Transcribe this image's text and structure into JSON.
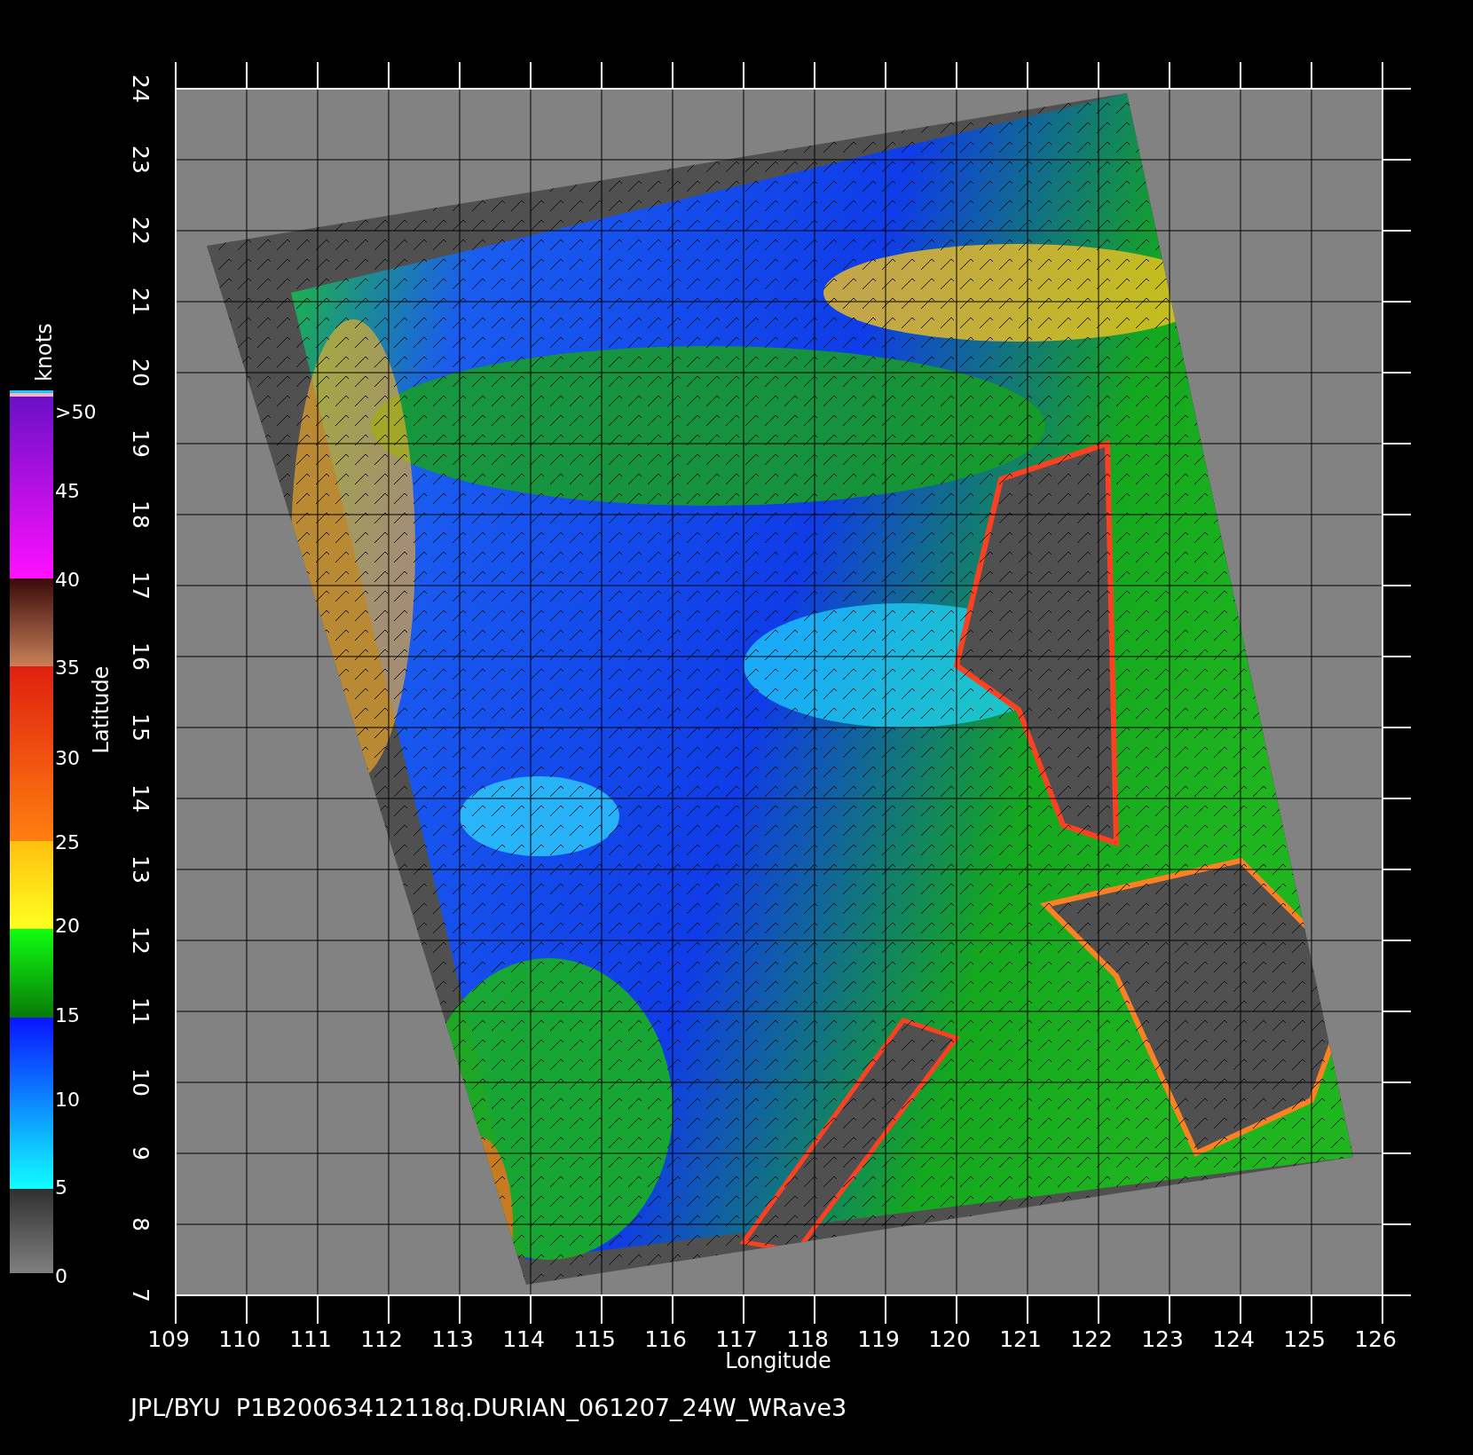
{
  "plot": {
    "longitude_ticks": [
      "109",
      "110",
      "111",
      "112",
      "113",
      "114",
      "115",
      "116",
      "117",
      "118",
      "119",
      "120",
      "121",
      "122",
      "123",
      "124",
      "125",
      "126"
    ],
    "latitude_ticks": [
      "24",
      "23",
      "22",
      "21",
      "20",
      "19",
      "18",
      "17",
      "16",
      "15",
      "14",
      "13",
      "12",
      "11",
      "10",
      "9",
      "8",
      "7"
    ],
    "xlabel": "Longitude",
    "ylabel": "Latitude"
  },
  "colorbar": {
    "unit": "knots",
    "labels": [
      ">50",
      "45",
      "40",
      "35",
      "30",
      "25",
      "20",
      "15",
      "10",
      "5",
      "0"
    ]
  },
  "footer": "JPL/BYU  P1B20063412118q.DURIAN_061207_24W_WRave3"
}
